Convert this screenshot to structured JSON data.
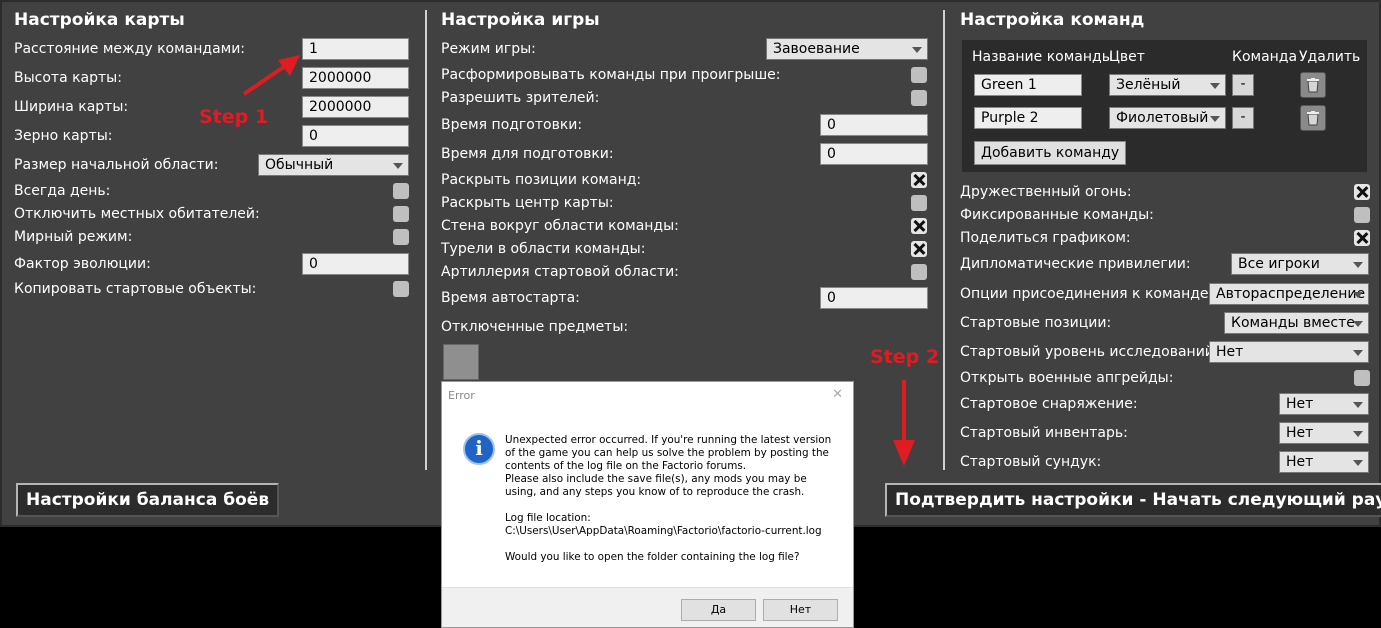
{
  "map": {
    "title": "Настройка карты",
    "team_distance_label": "Расстояние между командами:",
    "team_distance_value": "1",
    "height_label": "Высота карты:",
    "height_value": "2000000",
    "width_label": "Ширина карты:",
    "width_value": "2000000",
    "seed_label": "Зерно карты:",
    "seed_value": "0",
    "start_size_label": "Размер начальной области:",
    "start_size_value": "Обычный",
    "always_day_label": "Всегда день:",
    "disable_natives_label": "Отключить местных обитателей:",
    "peaceful_label": "Мирный режим:",
    "evolution_label": "Фактор эволюции:",
    "evolution_value": "0",
    "copy_start_label": "Копировать стартовые объекты:"
  },
  "game": {
    "title": "Настройка игры",
    "mode_label": "Режим игры:",
    "mode_value": "Завоевание",
    "disband_label": "Расформировывать команды при проигрыше:",
    "spectators_label": "Разрешить зрителей:",
    "prep_time_label": "Время подготовки:",
    "prep_time_value": "0",
    "prep_time2_label": "Время для подготовки:",
    "prep_time2_value": "0",
    "reveal_positions_label": "Раскрыть позиции команд:",
    "reveal_center_label": "Раскрыть центр карты:",
    "wall_label": "Стена вокруг области команды:",
    "turrets_label": "Турели в области команды:",
    "artillery_label": "Артиллерия стартовой области:",
    "autostart_label": "Время автостарта:",
    "autostart_value": "0",
    "disabled_items_label": "Отключенные предметы:"
  },
  "teams": {
    "title": "Настройка команд",
    "col_name": "Название команды",
    "col_color": "Цвет",
    "col_team": "Команда",
    "col_delete": "Удалить",
    "rows": [
      {
        "name": "Green 1",
        "color": "Зелёный",
        "minus": "-"
      },
      {
        "name": "Purple 2",
        "color": "Фиолетовый",
        "minus": "-"
      }
    ],
    "add_team": "Добавить команду",
    "friendly_fire_label": "Дружественный огонь:",
    "locked_teams_label": "Фиксированные команды:",
    "share_chart_label": "Поделиться графиком:",
    "diplomacy_label": "Дипломатические привилегии:",
    "diplomacy_value": "Все игроки",
    "join_options_label": "Опции присоединения к команде:",
    "join_options_value": "Автораспределение",
    "start_positions_label": "Стартовые позиции:",
    "start_positions_value": "Команды вместе",
    "research_label": "Стартовый уровень исследований:",
    "research_value": "Нет",
    "military_label": "Открыть военные апгрейды:",
    "equipment_label": "Стартовое снаряжение:",
    "equipment_value": "Нет",
    "inventory_label": "Стартовый инвентарь:",
    "inventory_value": "Нет",
    "chest_label": "Стартовый сундук:",
    "chest_value": "Нет"
  },
  "buttons": {
    "balance": "Настройки баланса боёв",
    "confirm": "Подтвердить настройки - Начать следующий раунд"
  },
  "annotations": {
    "step1": "Step 1",
    "step2": "Step 2",
    "color": "#e11b22"
  },
  "dialog": {
    "title": "Error",
    "icon": "info-icon",
    "line1": "Unexpected error occurred. If you're running the latest version of the game you can help us solve the problem by posting the contents of the log file on the Factorio forums.",
    "line2": "Please also include the save file(s), any mods you may be using, and any steps you know of to reproduce the crash.",
    "line3": "Log file location:",
    "line4": "C:\\Users\\User\\AppData\\Roaming\\Factorio\\factorio-current.log",
    "line5": "Would you like to open the folder containing the log file?",
    "yes": "Да",
    "no": "Нет"
  }
}
